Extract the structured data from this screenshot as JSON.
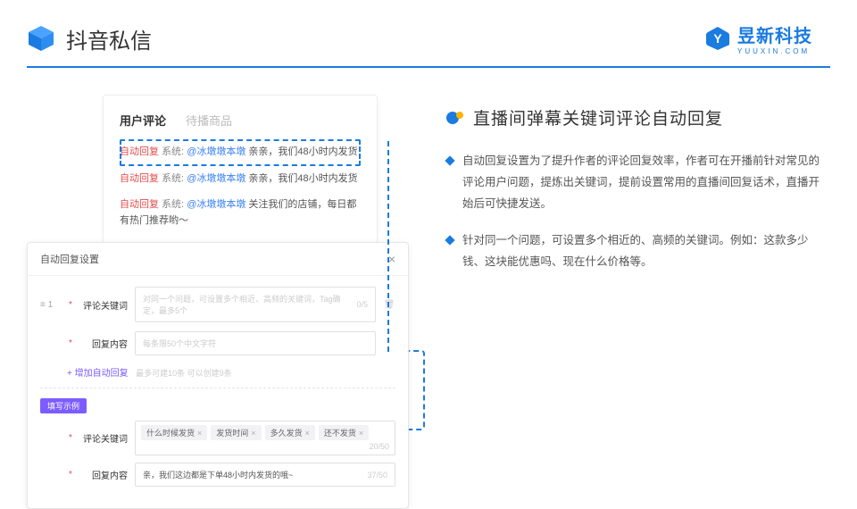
{
  "header": {
    "title": "抖音私信",
    "brand_name": "昱新科技",
    "brand_url": "YUUXIN.COM"
  },
  "comments": {
    "tab_active": "用户评论",
    "tab_inactive": "待播商品",
    "items": [
      {
        "auto": "自动回复",
        "sys": "系统:",
        "user": "@冰墩墩本墩",
        "text": " 亲亲，我们48小时内发货"
      },
      {
        "auto": "自动回复",
        "sys": "系统:",
        "user": "@冰墩墩本墩",
        "text": " 亲亲，我们48小时内发货"
      },
      {
        "auto": "自动回复",
        "sys": "系统:",
        "user": "@冰墩墩本墩",
        "text": " 关注我们的店铺，每日都有热门推荐哟～"
      }
    ]
  },
  "settings": {
    "title": "自动回复设置",
    "index": "1",
    "keyword_label": "评论关键词",
    "keyword_placeholder": "对同一个问题，可设置多个相近、高频的关键词，Tag确定，最多5个",
    "keyword_counter": "0/5",
    "content_label": "回复内容",
    "content_placeholder": "每条限50个中文字符",
    "add_label": "+ 增加自动回复",
    "add_hint": "最多可建10条 可以创建9条",
    "example_badge": "填写示例",
    "ex_keyword_label": "评论关键词",
    "tags": [
      "什么时候发货",
      "发货时间",
      "多久发货",
      "还不发货"
    ],
    "ex_tag_counter": "20/50",
    "ex_content_label": "回复内容",
    "ex_content_value": "亲，我们这边都是下单48小时内发货的哦~",
    "ex_content_counter": "37/50"
  },
  "right": {
    "title": "直播间弹幕关键词评论自动回复",
    "bullets": [
      "自动回复设置为了提升作者的评论回复效率，作者可在开播前针对常见的评论用户问题，提炼出关键词，提前设置常用的直播间回复话术，直播开始后可快捷发送。",
      "针对同一个问题，可设置多个相近的、高频的关键词。例如：这款多少钱、这块能优惠吗、现在什么价格等。"
    ]
  }
}
